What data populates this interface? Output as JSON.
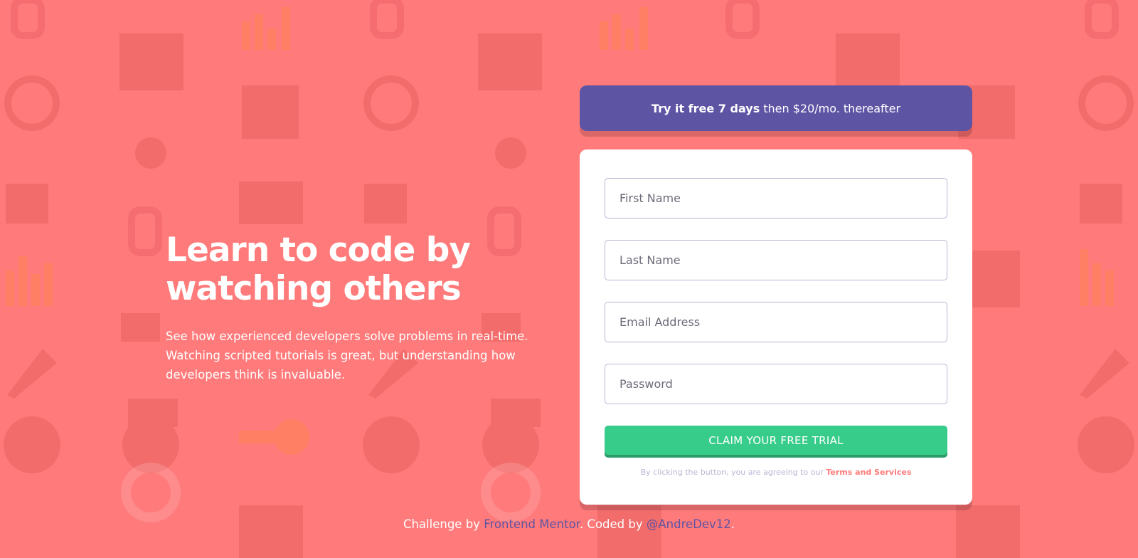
{
  "hero": {
    "title_line1": "Learn to code by",
    "title_line2": "watching others",
    "description": "See how experienced developers solve problems in real-time. Watching scripted tutorials is great, but understanding how developers think is invaluable."
  },
  "promo": {
    "bold": "Try it free 7 days",
    "rest": "then $20/mo. thereafter"
  },
  "form": {
    "first_name_placeholder": "First Name",
    "last_name_placeholder": "Last Name",
    "email_placeholder": "Email Address",
    "password_placeholder": "Password",
    "submit_label": "CLAIM YOUR FREE TRIAL",
    "terms_prefix": "By clicking the button, you are agreeing to our",
    "terms_link": "Terms and Services"
  },
  "footer": {
    "prefix": "Challenge by",
    "mentor_link": "Frontend Mentor",
    "middle": ". Coded by",
    "author_link": "@AndreDev12",
    "suffix": "."
  },
  "colors": {
    "background": "#ff7a7a",
    "accent_purple": "#5e54a4",
    "accent_green": "#38cc8b",
    "muted": "#b9b6d3"
  }
}
